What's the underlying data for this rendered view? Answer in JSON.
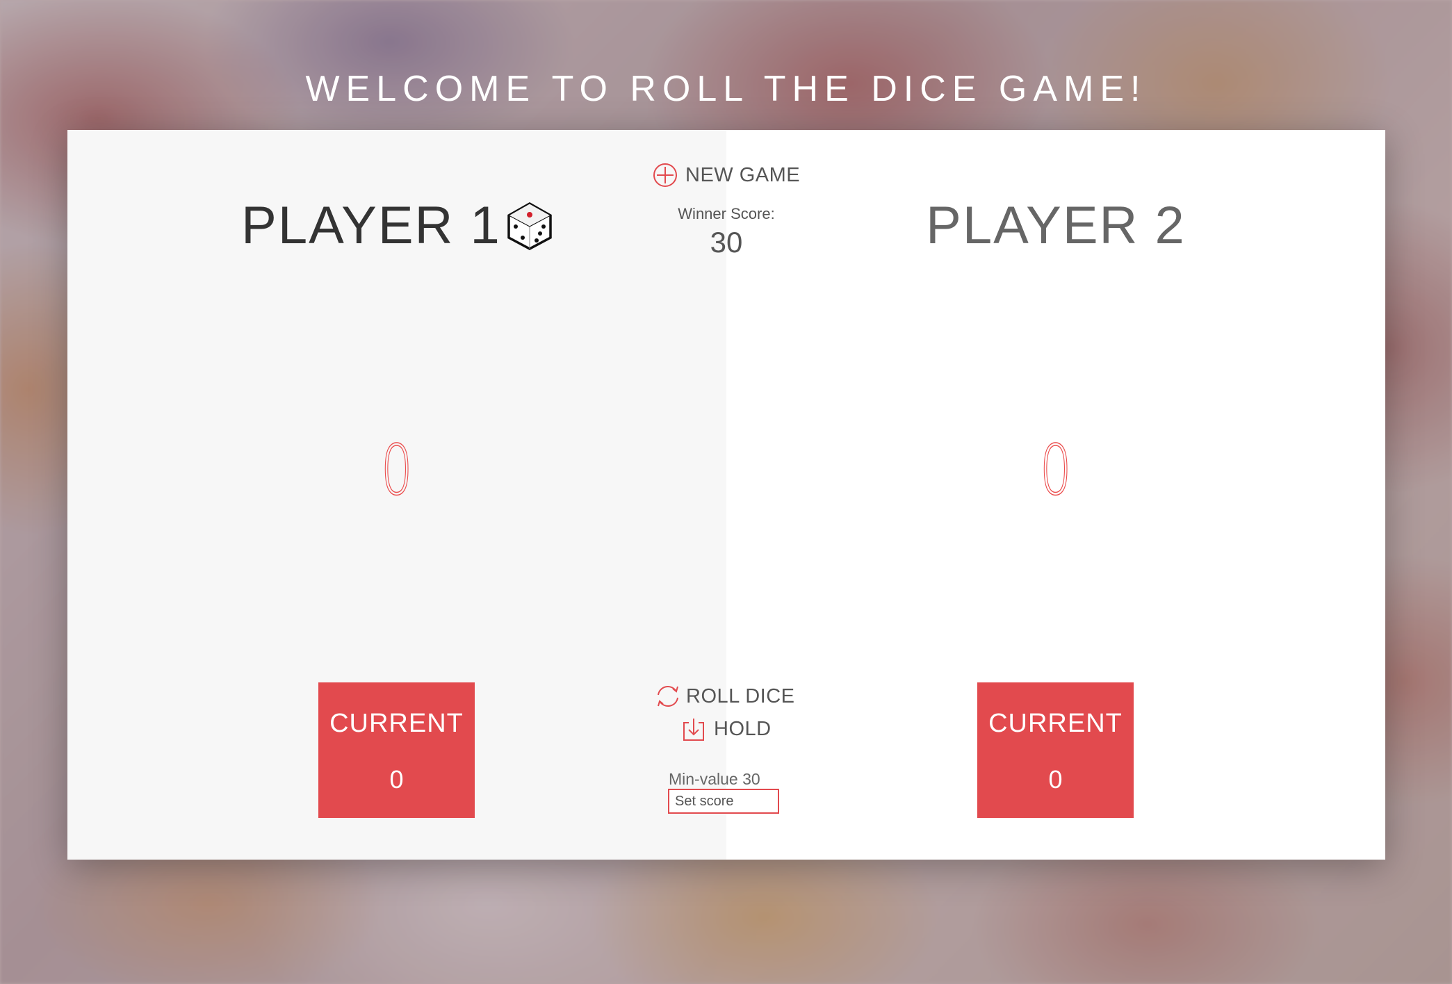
{
  "header": {
    "title": "WELCOME TO ROLL THE DICE GAME!"
  },
  "controls": {
    "new_game_label": "NEW GAME",
    "winner_score_label": "Winner Score:",
    "winner_score_value": "30",
    "roll_dice_label": "ROLL DICE",
    "hold_label": "HOLD",
    "min_value_label": "Min-value 30",
    "set_score_placeholder": "Set score"
  },
  "players": [
    {
      "name": "PLAYER 1",
      "score": "0",
      "current_label": "CURRENT",
      "current_score": "0",
      "active": true
    },
    {
      "name": "PLAYER 2",
      "score": "0",
      "current_label": "CURRENT",
      "current_score": "0",
      "active": false
    }
  ],
  "colors": {
    "accent": "#e24a4e",
    "active_panel": "#f7f7f7",
    "inactive_panel": "#ffffff"
  },
  "icons": {
    "new_game": "plus-circle-icon",
    "roll_dice": "refresh-icon",
    "hold": "download-icon",
    "active_player": "dice-icon"
  }
}
